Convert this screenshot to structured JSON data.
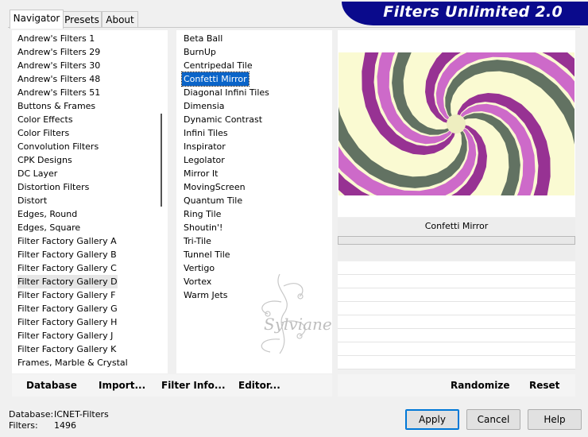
{
  "tabs": [
    {
      "label": "Navigator",
      "active": true
    },
    {
      "label": "Presets",
      "active": false
    },
    {
      "label": "About",
      "active": false
    }
  ],
  "banner": {
    "title": "Filters Unlimited 2.0"
  },
  "categories": {
    "items": [
      "Andrew's Filters 1",
      "Andrew's Filters 29",
      "Andrew's Filters 30",
      "Andrew's Filters 48",
      "Andrew's Filters 51",
      "Buttons & Frames",
      "Color Effects",
      "Color Filters",
      "Convolution Filters",
      "CPK Designs",
      "DC Layer",
      "Distortion Filters",
      "Distort",
      "Edges, Round",
      "Edges, Square",
      "Filter Factory Gallery A",
      "Filter Factory Gallery B",
      "Filter Factory Gallery C",
      "Filter Factory Gallery D",
      "Filter Factory Gallery F",
      "Filter Factory Gallery G",
      "Filter Factory Gallery H",
      "Filter Factory Gallery J",
      "Filter Factory Gallery K",
      "Frames, Marble & Crystal"
    ],
    "selected": "Filter Factory Gallery D"
  },
  "filters": {
    "items": [
      "Beta Ball",
      "BurnUp",
      "Centripedal Tile",
      "Confetti Mirror",
      "Diagonal Infini Tiles",
      "Dimensia",
      "Dynamic Contrast",
      "Infini Tiles",
      "Inspirator",
      "Legolator",
      "Mirror It",
      "MovingScreen",
      "Quantum Tile",
      "Ring Tile",
      "Shoutin'!",
      "Tri-Tile",
      "Tunnel Tile",
      "Vertigo",
      "Vortex",
      "Warm Jets"
    ],
    "selected": "Confetti Mirror"
  },
  "preview": {
    "filter_name": "Confetti Mirror",
    "colors": [
      "#8c1c8c",
      "#c85ac8",
      "#fafad2",
      "#eeeec0",
      "#3c5046"
    ]
  },
  "toolbar": {
    "database": "Database",
    "import": "Import...",
    "filter_info": "Filter Info...",
    "editor": "Editor...",
    "randomize": "Randomize",
    "reset": "Reset"
  },
  "watermark": {
    "text": "Sylviane"
  },
  "status": {
    "database_label": "Database:",
    "database_value": "ICNET-Filters",
    "filters_label": "Filters:",
    "filters_value": "1496"
  },
  "buttons": {
    "apply": "Apply",
    "cancel": "Cancel",
    "help": "Help"
  }
}
